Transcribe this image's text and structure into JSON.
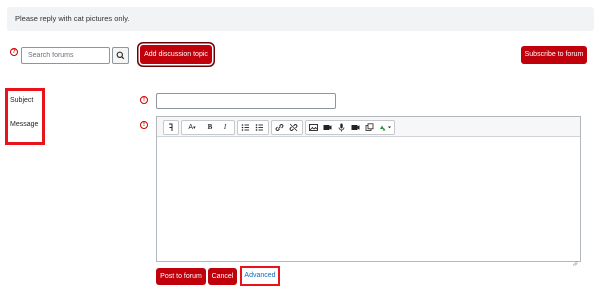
{
  "notice": {
    "text": "Please reply with cat pictures only."
  },
  "search": {
    "placeholder": "Search forums"
  },
  "buttons": {
    "add_topic": "Add discussion topic",
    "subscribe": "Subscribe to forum",
    "post": "Post to forum",
    "cancel": "Cancel",
    "advanced": "Advanced"
  },
  "form": {
    "subject_label": "Subject",
    "message_label": "Message"
  },
  "toolbar": {
    "paragraph": "¶",
    "font_color": "A",
    "bold": "B",
    "italic": "I"
  },
  "colors": {
    "brand": "#c0000b",
    "highlight_box": "#e8131b",
    "link": "#0f6cbf"
  }
}
